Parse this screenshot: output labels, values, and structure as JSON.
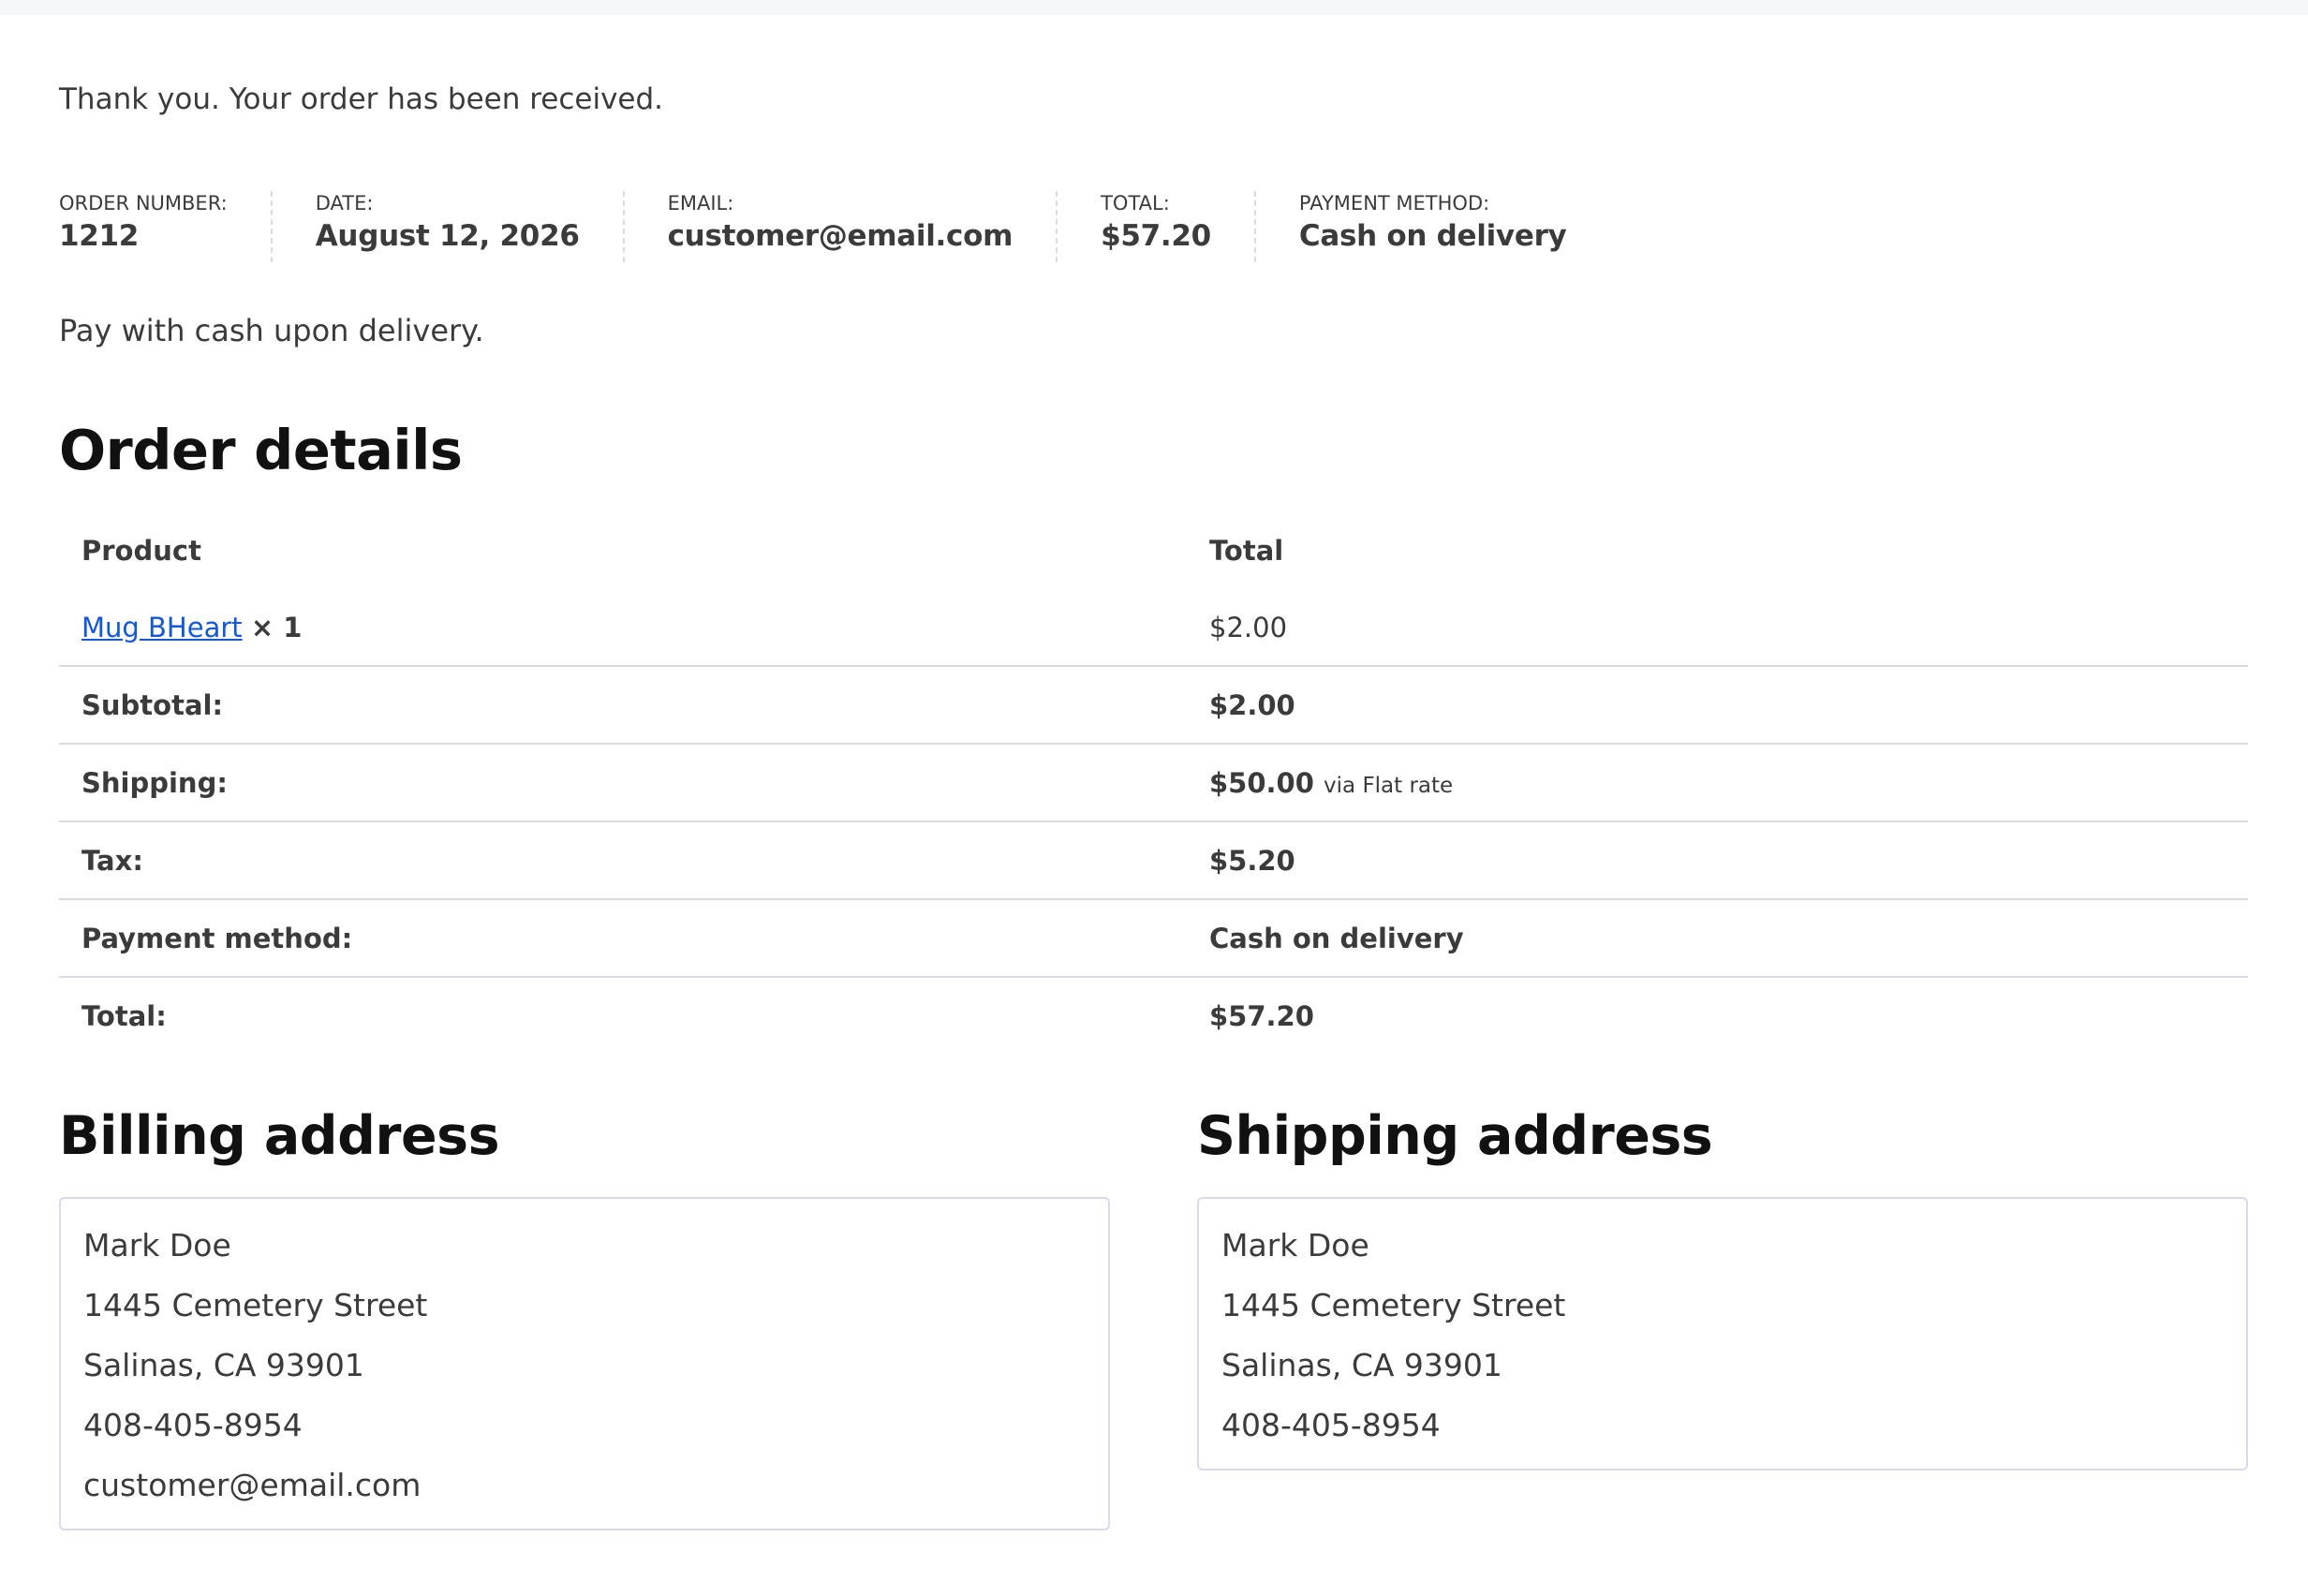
{
  "notice": "Thank you. Your order has been received.",
  "overview": [
    {
      "label": "Order number:",
      "value": "1212"
    },
    {
      "label": "Date:",
      "value": "August 12, 2026"
    },
    {
      "label": "Email:",
      "value": "customer@email.com"
    },
    {
      "label": "Total:",
      "value": "$57.20"
    },
    {
      "label": "Payment method:",
      "value": "Cash on delivery"
    }
  ],
  "payment_note": "Pay with cash upon delivery.",
  "order_details": {
    "title": "Order details",
    "columns": [
      "Product",
      "Total"
    ],
    "item": {
      "name": "Mug BHeart",
      "qty": "× 1",
      "total": "$2.00"
    },
    "rows": [
      {
        "label": "Subtotal:",
        "value": "$2.00"
      },
      {
        "label": "Shipping:",
        "value": "$50.00",
        "note": "via Flat rate"
      },
      {
        "label": "Tax:",
        "value": "$5.20"
      },
      {
        "label": "Payment method:",
        "value": "Cash on delivery"
      },
      {
        "label": "Total:",
        "value": "$57.20"
      }
    ]
  },
  "billing": {
    "title": "Billing address",
    "lines": [
      "Mark Doe",
      "1445 Cemetery Street",
      "Salinas, CA 93901",
      "408-405-8954",
      "customer@email.com"
    ]
  },
  "shipping": {
    "title": "Shipping address",
    "lines": [
      "Mark Doe",
      "1445 Cemetery Street",
      "Salinas, CA 93901",
      "408-405-8954"
    ]
  },
  "colors": {
    "link": "#1558d6",
    "text": "#3b3b3b",
    "heading": "#111111",
    "border": "#d8dbe6"
  }
}
